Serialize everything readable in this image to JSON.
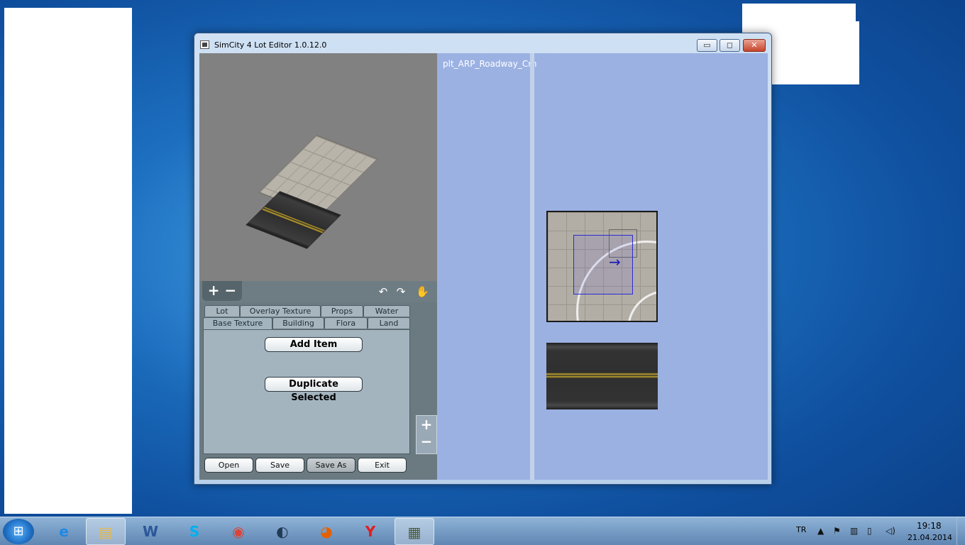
{
  "window": {
    "title": "SimCity 4 Lot Editor 1.0.12.0",
    "min_glyph": "▭",
    "max_glyph": "◻",
    "close_glyph": "✕"
  },
  "toolbar": {
    "zoom_in": "+",
    "zoom_out": "−",
    "rotate_left_glyph": "↶",
    "rotate_right_glyph": "↷",
    "hand_glyph": "✋"
  },
  "tabs": {
    "top_row": [
      "Lot",
      "Overlay Texture",
      "Props",
      "Water"
    ],
    "bottom_row": [
      "Base Texture",
      "Building",
      "Flora",
      "Land"
    ],
    "active": "Base Texture"
  },
  "panel": {
    "add_item": "Add Item",
    "duplicate_selected": "Duplicate Selected"
  },
  "buttons": {
    "open": "Open",
    "save": "Save",
    "save_as": "Save As",
    "exit": "Exit"
  },
  "side_zoom": {
    "plus": "+",
    "minus": "−"
  },
  "lot": {
    "name": "plt_ARP_Roadway_Crn",
    "arrow_glyph": "→"
  },
  "taskbar": {
    "apps": [
      {
        "name": "internet-explorer",
        "glyph": "e",
        "color": "#1e88e5"
      },
      {
        "name": "file-explorer",
        "glyph": "▤",
        "color": "#e8b84a"
      },
      {
        "name": "word",
        "glyph": "W",
        "color": "#2b579a"
      },
      {
        "name": "skype",
        "glyph": "S",
        "color": "#00aff0"
      },
      {
        "name": "chrome",
        "glyph": "◉",
        "color": "#db4437"
      },
      {
        "name": "media-player",
        "glyph": "◐",
        "color": "#223a55"
      },
      {
        "name": "firefox",
        "glyph": "◕",
        "color": "#e66000"
      },
      {
        "name": "yandex",
        "glyph": "Y",
        "color": "#e31d1d"
      },
      {
        "name": "lot-editor",
        "glyph": "▦",
        "color": "#4b5a3c"
      }
    ],
    "start_glyph": "⊞",
    "lang": "TR",
    "time": "19:18",
    "date": "21.04.2014"
  }
}
